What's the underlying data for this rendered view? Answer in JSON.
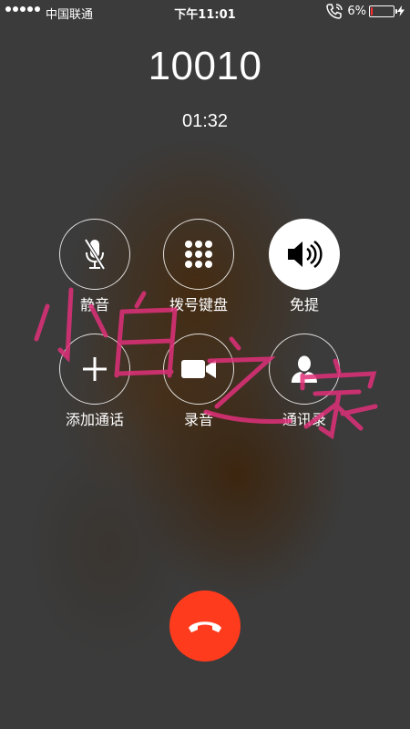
{
  "status_bar": {
    "carrier": "中国联通",
    "time": "下午11:01",
    "battery_percent": "6%",
    "battery_level": 0.06,
    "icons": [
      "signal-dots-icon",
      "phone-wifi-call-icon",
      "battery-icon",
      "charging-bolt-icon"
    ]
  },
  "call": {
    "number": "10010",
    "duration": "01:32"
  },
  "controls": [
    {
      "label": "静音",
      "icon": "mute-microphone-icon",
      "active": false
    },
    {
      "label": "拨号键盘",
      "icon": "keypad-icon",
      "active": false
    },
    {
      "label": "免提",
      "icon": "speaker-icon",
      "active": true
    },
    {
      "label": "添加通话",
      "icon": "plus-icon",
      "active": false
    },
    {
      "label": "录音",
      "icon": "video-camera-icon",
      "active": false
    },
    {
      "label": "通讯录",
      "icon": "contact-person-icon",
      "active": false
    }
  ],
  "end_call": {
    "icon": "hang-up-phone-icon",
    "color": "#ff3b1e"
  },
  "watermark": {
    "text": "小白之家",
    "color": "#e0307a"
  },
  "colors": {
    "background": "#3b3b3b",
    "end_call": "#ff3b1e",
    "battery_low": "#ff2d2d"
  }
}
